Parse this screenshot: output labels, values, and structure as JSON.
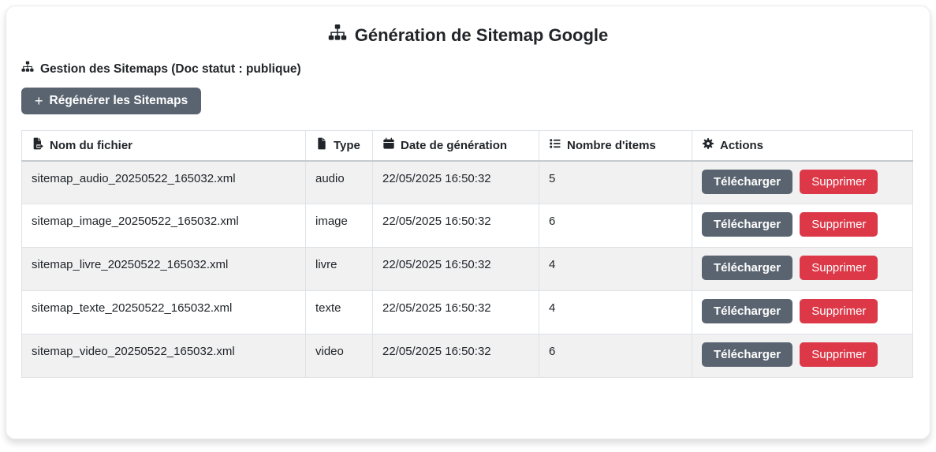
{
  "header": {
    "title": "Génération de Sitemap Google",
    "subtitle": "Gestion des Sitemaps (Doc statut : publique)",
    "title_icon": "sitemap-icon",
    "subtitle_icon": "sitemap-icon"
  },
  "toolbar": {
    "regenerate_plus": "+",
    "regenerate_label": "Régénérer les Sitemaps"
  },
  "table": {
    "headers": [
      {
        "label": "Nom du fichier",
        "icon": "file-export-icon"
      },
      {
        "label": "Type",
        "icon": "file-icon"
      },
      {
        "label": "Date de génération",
        "icon": "calendar-icon"
      },
      {
        "label": "Nombre d'items",
        "icon": "list-icon"
      },
      {
        "label": "Actions",
        "icon": "gear-icon"
      }
    ],
    "actions": {
      "download_label": "Télécharger",
      "delete_label": "Supprimer"
    },
    "rows": [
      {
        "filename": "sitemap_audio_20250522_165032.xml",
        "type": "audio",
        "date": "22/05/2025 16:50:32",
        "items": "5"
      },
      {
        "filename": "sitemap_image_20250522_165032.xml",
        "type": "image",
        "date": "22/05/2025 16:50:32",
        "items": "6"
      },
      {
        "filename": "sitemap_livre_20250522_165032.xml",
        "type": "livre",
        "date": "22/05/2025 16:50:32",
        "items": "4"
      },
      {
        "filename": "sitemap_texte_20250522_165032.xml",
        "type": "texte",
        "date": "22/05/2025 16:50:32",
        "items": "4"
      },
      {
        "filename": "sitemap_video_20250522_165032.xml",
        "type": "video",
        "date": "22/05/2025 16:50:32",
        "items": "6"
      }
    ]
  },
  "colors": {
    "button_grey": "#5a6470",
    "button_red": "#dc3848",
    "row_stripe": "#f1f1f2",
    "table_border": "#dee2e6",
    "text": "#212529"
  }
}
